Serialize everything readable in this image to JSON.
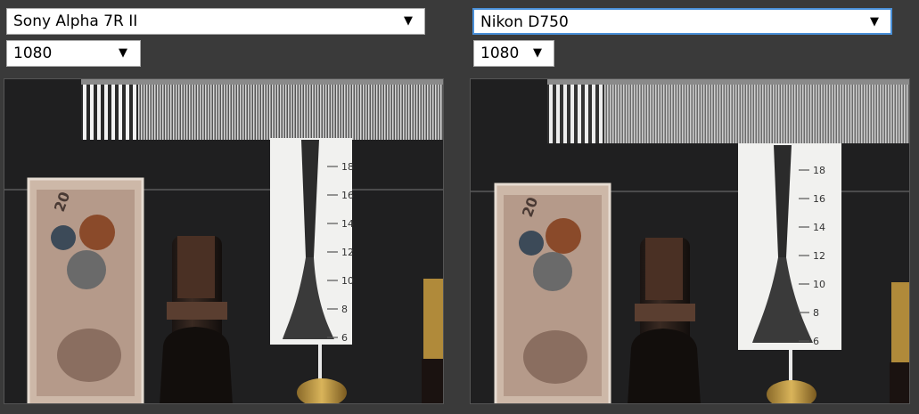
{
  "left": {
    "camera_select": {
      "value": "Sony Alpha 7R II",
      "arrow": "▼"
    },
    "resolution_select": {
      "value": "1080",
      "arrow": "▼"
    },
    "image": {
      "scale_ticks": [
        "18",
        "16",
        "14",
        "12",
        "10",
        "8",
        "6"
      ],
      "banknote_text": "20"
    }
  },
  "right": {
    "camera_select": {
      "value": "Nikon D750",
      "arrow": "▼"
    },
    "resolution_select": {
      "value": "1080",
      "arrow": "▼"
    },
    "image": {
      "scale_ticks": [
        "18",
        "16",
        "14",
        "12",
        "10",
        "8",
        "6"
      ],
      "banknote_text": "20"
    }
  },
  "colors": {
    "page_background": "#3a3a3a",
    "focus_border": "#4a90d9",
    "scene_background": "#1f1f20"
  }
}
